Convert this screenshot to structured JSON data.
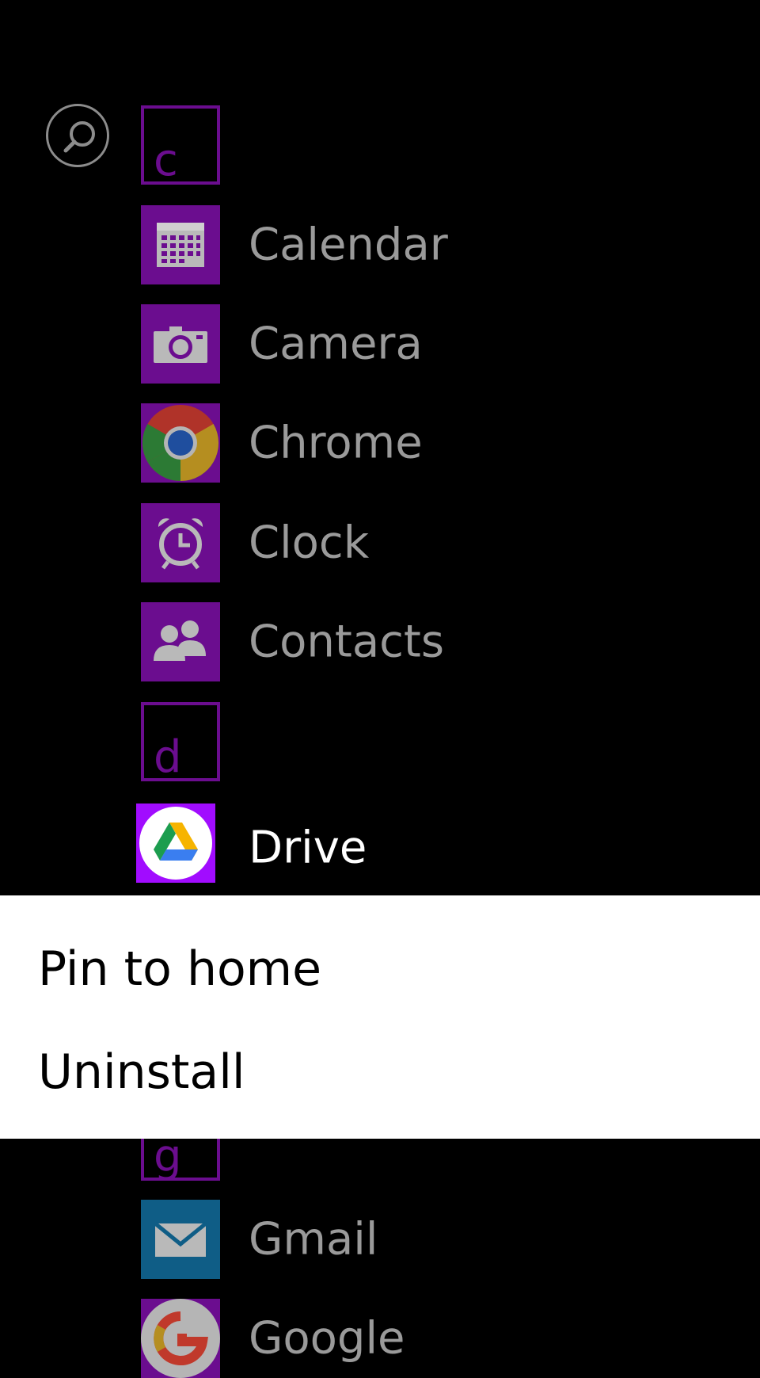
{
  "search": {
    "icon": "search-icon"
  },
  "apps": {
    "group_c": "c",
    "calendar": "Calendar",
    "camera": "Camera",
    "chrome": "Chrome",
    "clock": "Clock",
    "contacts": "Contacts",
    "group_d": "d",
    "drive": "Drive",
    "group_g": "g",
    "gmail": "Gmail",
    "google": "Google"
  },
  "context_menu": {
    "pin": "Pin to home",
    "uninstall": "Uninstall"
  },
  "colors": {
    "accent": "#6b0d8f",
    "accent_active": "#a10cff",
    "background": "#000000",
    "menu_background": "#ffffff",
    "gmail_tile": "#0f5d86"
  }
}
